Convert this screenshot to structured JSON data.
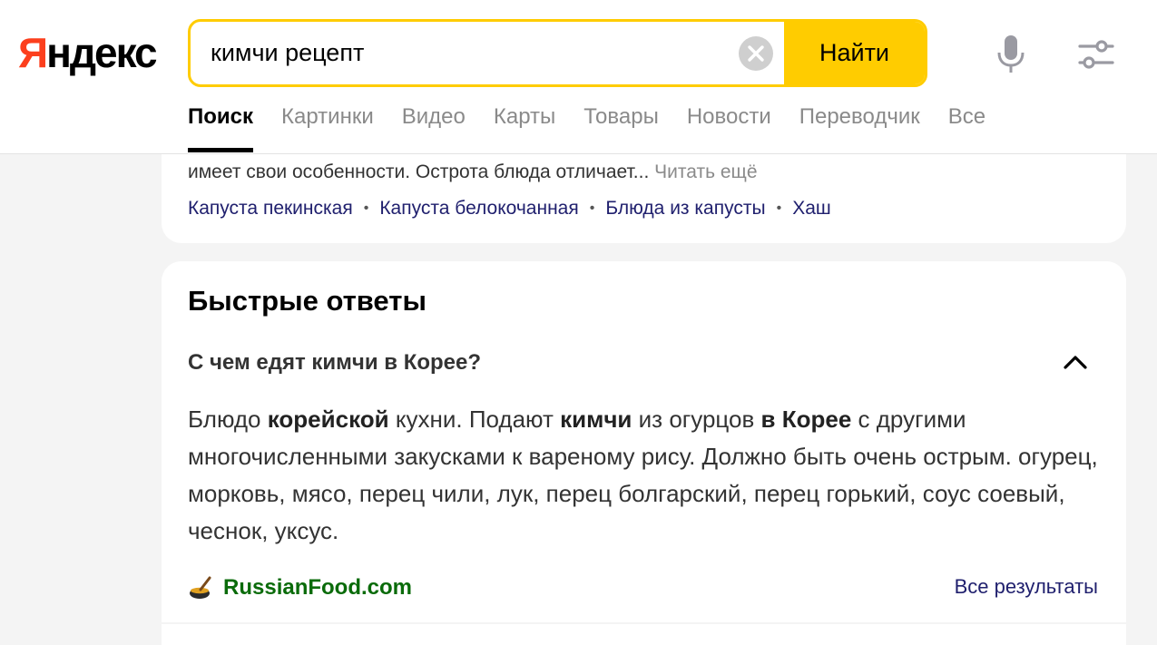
{
  "header": {
    "logo_first": "Я",
    "logo_rest": "ндекс",
    "search_value": "кимчи рецепт",
    "search_button": "Найти"
  },
  "nav": {
    "tabs": [
      {
        "label": "Поиск",
        "active": true
      },
      {
        "label": "Картинки"
      },
      {
        "label": "Видео"
      },
      {
        "label": "Карты"
      },
      {
        "label": "Товары"
      },
      {
        "label": "Новости"
      },
      {
        "label": "Переводчик"
      },
      {
        "label": "Все"
      }
    ]
  },
  "snippet": {
    "text": "имеет свои особенности. Острота блюда отличает...",
    "more": "Читать ещё",
    "related": [
      "Капуста пекинская",
      "Капуста белокочанная",
      "Блюда из капусты",
      "Хаш"
    ]
  },
  "quick_answers": {
    "title": "Быстрые ответы",
    "question": "С чем едят кимчи в Корее?",
    "answer": [
      {
        "t": "Блюдо ",
        "b": false
      },
      {
        "t": "корейской",
        "b": true
      },
      {
        "t": " кухни. Подают ",
        "b": false
      },
      {
        "t": "кимчи",
        "b": true
      },
      {
        "t": " из огурцов ",
        "b": false
      },
      {
        "t": "в Корее",
        "b": true
      },
      {
        "t": " с другими многочисленными закусками к вареному рису. Должно быть очень острым. огурец, морковь, мясо, перец чили, лук, перец болгарский, перец горький, соус соевый, чеснок, уксус.",
        "b": false
      }
    ],
    "source_name": "RussianFood.com",
    "all_results": "Все результаты"
  },
  "colors": {
    "brand_red": "#fc3f1d",
    "accent_yellow": "#ffcc00",
    "link": "#20206e",
    "source_green": "#0a6b0a"
  },
  "icons": [
    "clear-icon",
    "mic-icon",
    "settings-icon",
    "chevron-up-icon",
    "source-favicon-icon"
  ]
}
